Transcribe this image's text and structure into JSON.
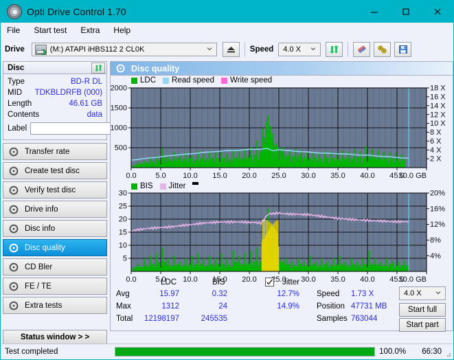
{
  "window": {
    "title": "Opti Drive Control 1.70",
    "icon": "disc-icon",
    "minimize": "minimize-icon",
    "maximize": "maximize-icon",
    "close": "close-icon"
  },
  "menu": {
    "items": [
      "File",
      "Start test",
      "Extra",
      "Help"
    ]
  },
  "toolbar": {
    "drive_label": "Drive",
    "drive_value": "(M:) ATAPI iHBS112  2 CL0K",
    "eject_icon": "eject-icon",
    "speed_label": "Speed",
    "speed_value": "4.0 X",
    "refresh_icon": "refresh-icon",
    "erase_icon": "eraser-icon",
    "tools_icon": "tools-icon",
    "save_icon": "save-icon"
  },
  "disc_panel": {
    "title": "Disc",
    "refresh_icon": "refresh-icon",
    "fields": [
      {
        "label": "Type",
        "value": "BD-R DL"
      },
      {
        "label": "MID",
        "value": "TDKBLDRFB (000)"
      },
      {
        "label": "Length",
        "value": "46.61 GB"
      },
      {
        "label": "Contents",
        "value": "data"
      }
    ],
    "label_field": {
      "label": "Label",
      "value": "",
      "placeholder": ""
    },
    "disc_icon": "cd-icon"
  },
  "sidebar": {
    "items": [
      {
        "label": "Transfer rate",
        "icon": "disc-icon",
        "selected": false
      },
      {
        "label": "Create test disc",
        "icon": "disc-icon",
        "selected": false
      },
      {
        "label": "Verify test disc",
        "icon": "disc-icon",
        "selected": false
      },
      {
        "label": "Drive info",
        "icon": "disc-icon",
        "selected": false
      },
      {
        "label": "Disc info",
        "icon": "disc-icon",
        "selected": false
      },
      {
        "label": "Disc quality",
        "icon": "disc-icon",
        "selected": true
      },
      {
        "label": "CD Bler",
        "icon": "disc-icon",
        "selected": false
      },
      {
        "label": "FE / TE",
        "icon": "disc-icon",
        "selected": false
      },
      {
        "label": "Extra tests",
        "icon": "disc-icon",
        "selected": false
      }
    ],
    "status_window": "Status window > >"
  },
  "main": {
    "header": {
      "title": "Disc quality",
      "icon": "disc-icon"
    }
  },
  "chart_data": [
    {
      "type": "area",
      "id": "ldc-chart",
      "title": "",
      "xlabel": "GB",
      "ylabel": "",
      "xlim": [
        0,
        50
      ],
      "ylim": [
        0,
        2000
      ],
      "y2lim": [
        0,
        18
      ],
      "y2label": "X",
      "grid": true,
      "legend_position": "top-left",
      "legend": [
        {
          "name": "LDC",
          "color": "#00b400"
        },
        {
          "name": "Read speed",
          "color": "#8fd8f8"
        },
        {
          "name": "Write speed",
          "color": "#ff69d6"
        }
      ],
      "xticks": [
        "0.0",
        "5.0",
        "10.0",
        "15.0",
        "20.0",
        "25.0",
        "30.0",
        "35.0",
        "40.0",
        "45.0",
        "50.0 GB"
      ],
      "yticks": [
        "500",
        "1000",
        "1500",
        "2000"
      ],
      "y2ticks": [
        "2 X",
        "4 X",
        "6 X",
        "8 X",
        "10 X",
        "12 X",
        "14 X",
        "16 X",
        "18 X"
      ],
      "series": [
        {
          "name": "LDC",
          "color": "#00b400",
          "kind": "bars",
          "x": [
            0.3,
            0.8,
            1.3,
            1.8,
            2.3,
            2.8,
            3.3,
            3.8,
            4.3,
            4.8,
            5.3,
            5.8,
            6.3,
            6.8,
            7.3,
            7.8,
            8.3,
            8.8,
            9.3,
            9.8,
            10.3,
            10.8,
            11.3,
            11.8,
            12.3,
            12.8,
            13.3,
            13.8,
            14.3,
            14.8,
            15.3,
            15.8,
            16.3,
            16.8,
            17.3,
            17.8,
            18.3,
            18.8,
            19.3,
            19.8,
            20.3,
            20.8,
            21.3,
            21.8,
            22.3,
            22.6,
            22.9,
            23.2,
            23.4,
            23.6,
            23.8,
            24.0,
            24.3,
            24.6,
            24.9,
            25.3,
            25.8,
            26.3,
            26.8,
            27.3,
            27.8,
            28.3,
            28.8,
            29.3,
            29.8,
            30.3,
            30.8,
            31.3,
            31.8,
            32.3,
            32.8,
            33.3,
            33.8,
            34.3,
            34.8,
            35.3,
            35.8,
            36.3,
            36.8,
            37.3,
            37.8,
            38.3,
            38.8,
            39.3,
            39.8,
            40.3,
            40.8,
            41.3,
            41.8,
            42.3,
            42.8,
            43.3,
            43.8,
            44.3,
            44.8,
            45.3,
            45.8,
            46.3,
            46.8
          ],
          "y": [
            60,
            90,
            150,
            120,
            180,
            140,
            260,
            170,
            300,
            200,
            480,
            260,
            320,
            210,
            400,
            250,
            330,
            220,
            390,
            260,
            300,
            210,
            430,
            250,
            350,
            230,
            420,
            260,
            380,
            240,
            420,
            260,
            350,
            220,
            460,
            270,
            420,
            250,
            470,
            300,
            520,
            330,
            690,
            420,
            980,
            760,
            1150,
            1312,
            900,
            1050,
            700,
            860,
            560,
            620,
            520,
            470,
            520,
            330,
            420,
            300,
            480,
            320,
            420,
            280,
            400,
            260,
            380,
            250,
            360,
            240,
            420,
            260,
            400,
            250,
            380,
            240,
            430,
            260,
            400,
            250,
            460,
            280,
            420,
            260,
            540,
            300,
            470,
            290,
            430,
            260,
            400,
            250,
            380,
            240,
            360,
            230,
            340,
            220
          ]
        },
        {
          "name": "Read speed",
          "color": "#8fd8f8",
          "kind": "line",
          "axis": "y2",
          "x": [
            0,
            2,
            4,
            6,
            8,
            10,
            12,
            14,
            16,
            18,
            20,
            22,
            23,
            24,
            25,
            26,
            28,
            30,
            32,
            34,
            36,
            38,
            40,
            42,
            44,
            46,
            47
          ],
          "y": [
            1.7,
            2.0,
            2.3,
            2.6,
            2.9,
            3.1,
            3.4,
            3.6,
            3.8,
            3.9,
            4.1,
            4.2,
            4.3,
            3.8,
            4.1,
            3.9,
            3.7,
            3.5,
            3.3,
            3.2,
            3.1,
            2.9,
            2.8,
            2.6,
            2.4,
            2.2,
            2.1
          ]
        },
        {
          "name": "Write speed",
          "color": "#ff69d6",
          "kind": "line",
          "axis": "y2",
          "x": [],
          "y": []
        },
        {
          "name": "end marker",
          "color": "#49d2f2",
          "kind": "vline",
          "x": [
            47.0
          ]
        }
      ]
    },
    {
      "type": "area",
      "id": "bis-jitter-chart",
      "title": "",
      "xlabel": "GB",
      "ylabel": "",
      "xlim": [
        0,
        50
      ],
      "ylim": [
        0,
        30
      ],
      "y2lim": [
        0,
        20
      ],
      "y2label": "%",
      "grid": true,
      "legend_position": "top-left",
      "legend": [
        {
          "name": "BIS",
          "color": "#00b400"
        },
        {
          "name": "Jitter",
          "color": "#e8b4e8"
        }
      ],
      "xticks": [
        "0.0",
        "5.0",
        "10.0",
        "15.0",
        "20.0",
        "25.0",
        "30.0",
        "35.0",
        "40.0",
        "45.0",
        "50.0 GB"
      ],
      "yticks": [
        "5",
        "10",
        "15",
        "20",
        "25",
        "30"
      ],
      "y2ticks": [
        "4%",
        "8%",
        "12%",
        "16%",
        "20%"
      ],
      "series": [
        {
          "name": "BIS",
          "color": "#00b400",
          "kind": "bars",
          "x": [
            0.3,
            0.8,
            1.3,
            1.8,
            2.3,
            2.8,
            3.3,
            3.8,
            4.3,
            4.8,
            5.3,
            5.8,
            6.3,
            6.8,
            7.3,
            7.8,
            8.3,
            8.8,
            9.3,
            9.8,
            10.3,
            10.8,
            11.3,
            11.8,
            12.3,
            12.8,
            13.3,
            13.8,
            14.3,
            14.8,
            15.3,
            15.8,
            16.3,
            16.8,
            17.3,
            17.8,
            18.3,
            18.8,
            19.3,
            19.8,
            20.3,
            20.8,
            21.3,
            21.8,
            22.3,
            22.6,
            22.9,
            23.2,
            23.4,
            23.6,
            23.8,
            24.1,
            24.4,
            24.8,
            25.3,
            25.8,
            26.3,
            26.8,
            27.3,
            27.8,
            28.3,
            28.8,
            29.3,
            29.8,
            30.3,
            30.8,
            31.3,
            31.8,
            32.3,
            32.8,
            33.3,
            33.8,
            34.3,
            34.8,
            35.3,
            35.8,
            36.3,
            36.8,
            37.3,
            37.8,
            38.3,
            38.8,
            39.3,
            39.8,
            40.3,
            40.8,
            41.3,
            41.8,
            42.3,
            42.8,
            43.3,
            43.8,
            44.3,
            44.8,
            45.3,
            45.8,
            46.3,
            46.8
          ],
          "y": [
            1.5,
            2,
            3,
            2,
            5,
            2.5,
            6,
            3,
            7,
            3.5,
            9,
            4,
            5,
            2.5,
            6,
            3,
            4,
            2.5,
            5,
            3,
            6,
            3,
            7,
            3,
            5,
            2.5,
            6,
            3,
            5,
            3,
            7,
            3,
            5,
            2.5,
            8,
            4,
            6,
            3,
            7,
            3.5,
            8,
            4,
            9,
            4,
            12,
            8,
            14,
            24,
            11,
            17,
            10,
            9,
            6,
            5,
            4.5,
            4,
            5,
            3,
            4,
            2.5,
            5,
            3,
            4,
            2.5,
            6,
            3,
            4,
            2.5,
            5,
            3,
            4,
            2.5,
            5,
            3,
            6,
            3,
            4,
            2.5,
            5,
            3,
            4,
            2.5,
            5,
            3,
            8,
            3,
            5,
            3,
            4,
            2.5,
            5,
            3,
            4,
            2.5,
            4,
            2.5,
            4,
            2.5
          ]
        },
        {
          "name": "Jitter",
          "color": "#e8b4e8",
          "kind": "line",
          "axis": "y2",
          "x": [
            0,
            1,
            2,
            3,
            4,
            5,
            6,
            7,
            8,
            9,
            10,
            11,
            12,
            13,
            14,
            15,
            16,
            17,
            18,
            19,
            20,
            21,
            22,
            23,
            23.5,
            24,
            25,
            26,
            27,
            28,
            29,
            30,
            31,
            32,
            33,
            34,
            35,
            36,
            37,
            38,
            39,
            40,
            41,
            42,
            43,
            44,
            45,
            46,
            47
          ],
          "y": [
            10.3,
            10.6,
            10.8,
            11.0,
            11.1,
            11.2,
            11.3,
            11.4,
            11.6,
            11.8,
            11.9,
            12.1,
            12.3,
            12.4,
            12.5,
            12.6,
            12.6,
            12.6,
            12.6,
            12.6,
            12.5,
            12.5,
            12.3,
            14.3,
            14.8,
            14.7,
            14.9,
            14.7,
            14.6,
            14.6,
            14.5,
            14.5,
            14.3,
            14.1,
            13.9,
            13.7,
            13.5,
            13.4,
            13.3,
            13.2,
            13.1,
            13.0,
            12.9,
            12.9,
            12.8,
            12.7,
            12.7,
            12.7,
            12.7
          ]
        },
        {
          "name": "end marker",
          "color": "#49d2f2",
          "kind": "vline",
          "x": [
            47.0
          ]
        }
      ]
    }
  ],
  "stats": {
    "col_headers": [
      "LDC",
      "BIS"
    ],
    "jitter_label": "Jitter",
    "jitter_checked": true,
    "rows": [
      {
        "label": "Avg",
        "ldc": "15.97",
        "bis": "0.32",
        "jitter": "12.7%"
      },
      {
        "label": "Max",
        "ldc": "1312",
        "bis": "24",
        "jitter": "14.9%"
      },
      {
        "label": "Total",
        "ldc": "12198197",
        "bis": "245535",
        "jitter": ""
      }
    ],
    "speed_label": "Speed",
    "speed_value": "1.73 X",
    "position_label": "Position",
    "position_value": "47731 MB",
    "samples_label": "Samples",
    "samples_value": "763044",
    "speed_select": "4.0 X",
    "start_full": "Start full",
    "start_part": "Start part"
  },
  "statusbar": {
    "message": "Test completed",
    "progress_percent": "100.0%",
    "progress_value": 100,
    "elapsed": "66:30"
  },
  "colors": {
    "titlebar": "#00b4c8",
    "accent_blue": "#2a2ae0",
    "selected_nav": "#0d8fd8",
    "plot_bg": "#6b7a93",
    "ldc_green": "#00b400",
    "read_speed": "#8fd8f8",
    "write_speed": "#ff69d6",
    "jitter_pink": "#e8b4e8",
    "marker_cyan": "#49d2f2",
    "progress_green": "#00a814"
  }
}
